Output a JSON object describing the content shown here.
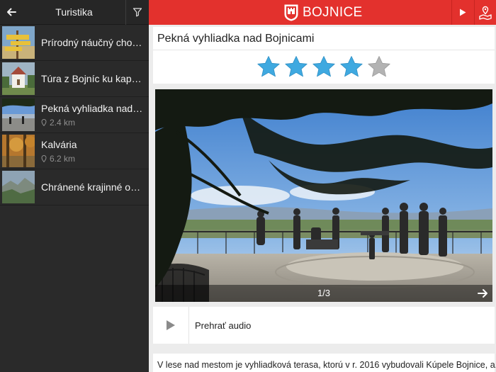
{
  "sidebar": {
    "title": "Turistika",
    "items": [
      {
        "title": "Prírodný náučný chod…",
        "distance": ""
      },
      {
        "title": "Túra z Bojníc ku kapln…",
        "distance": ""
      },
      {
        "title": "Pekná vyhliadka nad B…",
        "distance": "2.4 km"
      },
      {
        "title": "Kalvária",
        "distance": "6.2 km"
      },
      {
        "title": "Chránené krajinné obla…",
        "distance": ""
      }
    ]
  },
  "header": {
    "brand": "BOJNICE",
    "accent_color": "#e3312d"
  },
  "poi": {
    "title": "Pekná vyhliadka nad Bojnicami",
    "rating": 4,
    "rating_max": 5,
    "star_color": "#3fa9e0",
    "star_empty_color": "#b3b3b3"
  },
  "gallery": {
    "counter": "1/3"
  },
  "audio": {
    "label": "Prehrať audio"
  },
  "description": {
    "text": "V lese nad mestom je vyhliadková terasa, ktorú v r. 2016 vybudovali Kúpele Bojnice, a.s."
  },
  "icons": [
    "back-arrow-icon",
    "filter-icon",
    "castle-logo-icon",
    "play-icon",
    "map-icon",
    "location-pin-icon",
    "next-arrow-icon",
    "audio-play-icon"
  ]
}
